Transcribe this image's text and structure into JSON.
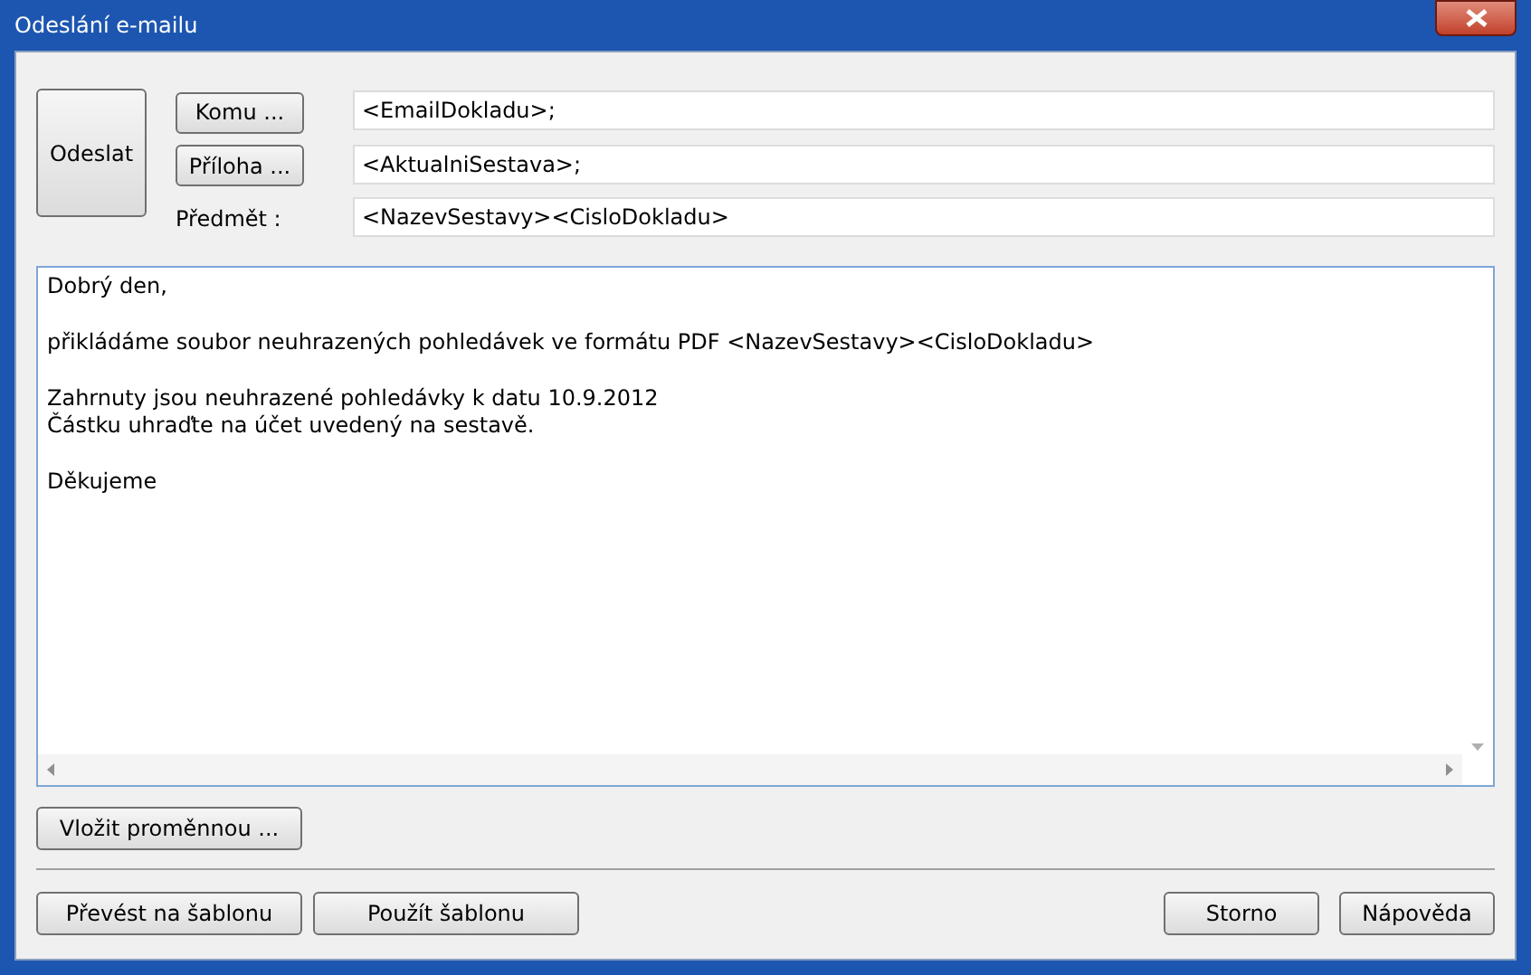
{
  "window": {
    "title": "Odeslání e-mailu"
  },
  "send_button": "Odeslat",
  "fields": [
    {
      "kind": "button",
      "label": "Komu ...",
      "value": "<EmailDokladu>;"
    },
    {
      "kind": "button",
      "label": "Příloha ...",
      "value": "<AktualniSestava>;"
    },
    {
      "kind": "label",
      "label": "Předmět :",
      "value": "<NazevSestavy><CisloDokladu>"
    }
  ],
  "body": [
    [
      "Dobrý den,"
    ],
    [
      "přikládáme soubor neuhrazených pohledávek ve formátu PDF <NazevSestavy><CisloDokladu>"
    ],
    [
      "Zahrnuty jsou neuhrazené pohledávky k datu 10.9.2012",
      "Částku uhraďte na účet uvedený na sestavě."
    ],
    [
      "Děkujeme"
    ]
  ],
  "insert_button": "Vložit proměnnou ...",
  "footer_left": [
    "Převést na šablonu",
    "Použít šablonu"
  ],
  "footer_right": [
    "Storno",
    "Nápověda"
  ]
}
